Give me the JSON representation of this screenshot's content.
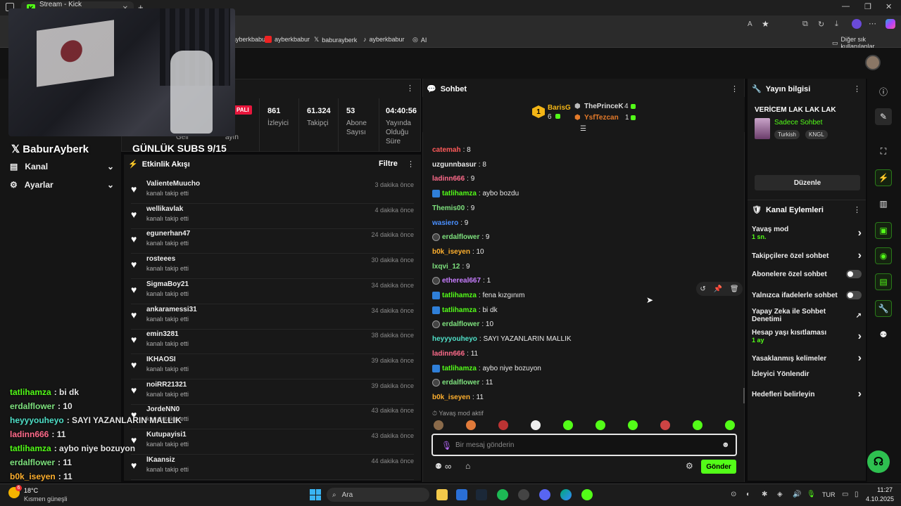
{
  "browser": {
    "tab_title": "Stream - Kick Dashboard",
    "new_tab": "+",
    "bookmarks": [
      "ayberkbabur",
      "ayberkbabur",
      "baburayberk",
      "ayberkbabur",
      "AI"
    ],
    "other_favorites": "Diğer sık kullanılanlar"
  },
  "overlay": {
    "handle": "BaburAyberk",
    "subs_goal": "GÜNLÜK SUBS 9/15"
  },
  "left_nav": [
    {
      "label": "Kanal"
    },
    {
      "label": "Ayarlar"
    }
  ],
  "overlay_chat": [
    {
      "user": "tatlihamza",
      "msg": ": bi dk",
      "color": "#53fc18"
    },
    {
      "user": "erdalflower",
      "msg": ": 10",
      "color": "#7ee27e"
    },
    {
      "user": "heyyyouheyo",
      "msg": ": SAYI YAZANLARIN MALLIK",
      "color": "#4fe0c8"
    },
    {
      "user": "ladinn666",
      "msg": ": 11",
      "color": "#ff6b8b"
    },
    {
      "user": "tatlihamza",
      "msg": ": aybo niye bozuyon",
      "color": "#53fc18"
    },
    {
      "user": "erdalflower",
      "msg": ": 11",
      "color": "#7ee27e"
    },
    {
      "user": "b0k_iseyen",
      "msg": ": 11",
      "color": "#ffb02e"
    }
  ],
  "stats": {
    "live_badge": "PALI",
    "partial1": "Geli",
    "partial2": "klu\nayın",
    "items": [
      {
        "value": "861",
        "label": "İzleyici"
      },
      {
        "value": "61.324",
        "label": "Takipçi"
      },
      {
        "value": "53",
        "label": "Abone Sayısı"
      },
      {
        "value": "04:40:56",
        "label": "Yayında Olduğu Süre"
      }
    ]
  },
  "activity": {
    "title": "Etkinlik Akışı",
    "filter": "Filtre",
    "items": [
      {
        "name": "ValienteMuucho",
        "sub": "kanalı takip etti",
        "time": "3 dakika önce"
      },
      {
        "name": "wellikavlak",
        "sub": "kanalı takip etti",
        "time": "4 dakika önce"
      },
      {
        "name": "egunerhan47",
        "sub": "kanalı takip etti",
        "time": "24 dakika önce"
      },
      {
        "name": "rosteees",
        "sub": "kanalı takip etti",
        "time": "30 dakika önce"
      },
      {
        "name": "SigmaBoy21",
        "sub": "kanalı takip etti",
        "time": "34 dakika önce"
      },
      {
        "name": "ankaramessi31",
        "sub": "kanalı takip etti",
        "time": "34 dakika önce"
      },
      {
        "name": "emin3281",
        "sub": "kanalı takip etti",
        "time": "38 dakika önce"
      },
      {
        "name": "IKHAOSI",
        "sub": "kanalı takip etti",
        "time": "39 dakika önce"
      },
      {
        "name": "noiRR21321",
        "sub": "kanalı takip etti",
        "time": "39 dakika önce"
      },
      {
        "name": "JordeNN0",
        "sub": "kanalı takip etti",
        "time": "43 dakika önce"
      },
      {
        "name": "Kutupayisi1",
        "sub": "kanalı takip etti",
        "time": "43 dakika önce"
      },
      {
        "name": "lKaansiz",
        "sub": "kanalı takip etti",
        "time": "44 dakika önce"
      }
    ]
  },
  "chat": {
    "title": "Sohbet",
    "leaderboard": {
      "first_rank": "1",
      "first_user": "BarisG",
      "first_count": "6",
      "second_user": "ThePrinceK",
      "second_count": "4",
      "third_user": "YsfTezcan",
      "third_count": "1"
    },
    "messages": [
      {
        "user": "catemah",
        "text": ": 8",
        "color": "#ff5a5a",
        "badge": ""
      },
      {
        "user": "uzgunnbasur",
        "text": ": 8",
        "color": "#e8e8e8",
        "badge": ""
      },
      {
        "user": "ladinn666",
        "text": ": 9",
        "color": "#ff6b8b",
        "badge": ""
      },
      {
        "user": "tatlihamza",
        "text": ": aybo bozdu",
        "color": "#53fc18",
        "badge": "blue"
      },
      {
        "user": "Themis00",
        "text": ": 9",
        "color": "#7ee27e",
        "badge": ""
      },
      {
        "user": "wasiero",
        "text": ": 9",
        "color": "#4a90ff",
        "badge": ""
      },
      {
        "user": "erdalflower",
        "text": ": 9",
        "color": "#7ee27e",
        "badge": "gray"
      },
      {
        "user": "b0k_iseyen",
        "text": ": 10",
        "color": "#ffb02e",
        "badge": ""
      },
      {
        "user": "lxqvi_12",
        "text": ": 9",
        "color": "#7ee27e",
        "badge": ""
      },
      {
        "user": "ethereal667",
        "text": ": 1",
        "color": "#c77dff",
        "badge": "gray"
      },
      {
        "user": "tatlihamza",
        "text": ": fena kızgınım",
        "color": "#53fc18",
        "badge": "blue"
      },
      {
        "user": "tatlihamza",
        "text": ": bi dk",
        "color": "#53fc18",
        "badge": "blue"
      },
      {
        "user": "erdalflower",
        "text": ": 10",
        "color": "#7ee27e",
        "badge": "gray"
      },
      {
        "user": "heyyyouheyo",
        "text": ": SAYI YAZANLARIN MALLIK",
        "color": "#4fe0c8",
        "badge": ""
      },
      {
        "user": "ladinn666",
        "text": ": 11",
        "color": "#ff6b8b",
        "badge": ""
      },
      {
        "user": "tatlihamza",
        "text": ": aybo niye bozuyon",
        "color": "#53fc18",
        "badge": "blue"
      },
      {
        "user": "erdalflower",
        "text": ": 11",
        "color": "#7ee27e",
        "badge": "gray"
      },
      {
        "user": "b0k_iseyen",
        "text": ": 11",
        "color": "#ffb02e",
        "badge": ""
      }
    ],
    "slow_mode_note": "Yavaş mod aktif",
    "input_placeholder": "Bir mesaj gönderin",
    "send": "Gönder",
    "infinity": "∞"
  },
  "stream_info": {
    "title": "Yayın bilgisi",
    "stream_title": "VERİCEM LAK LAK LAK",
    "category": "Sadece Sohbet",
    "tags": [
      "Turkish",
      "KNGL"
    ],
    "edit": "Düzenle"
  },
  "channel_actions": {
    "title": "Kanal Eylemleri",
    "rows": [
      {
        "label": "Yavaş mod",
        "sub": "1 sn.",
        "control": "chevron"
      },
      {
        "label": "Takipçilere özel sohbet",
        "sub": "",
        "control": "chevron"
      },
      {
        "label": "Abonelere özel sohbet",
        "sub": "",
        "control": "toggle"
      },
      {
        "label": "Yalnızca ifadelerle sohbet",
        "sub": "",
        "control": "toggle"
      },
      {
        "label": "Yapay Zeka ile Sohbet Denetimi",
        "sub": "",
        "control": "external"
      },
      {
        "label": "Hesap yaşı kısıtlaması",
        "sub": "1 ay",
        "control": "chevron"
      },
      {
        "label": "Yasaklanmış kelimeler",
        "sub": "",
        "control": "chevron"
      },
      {
        "label": "İzleyici Yönlendir",
        "sub": "",
        "control": "none"
      },
      {
        "label": "Hedefleri belirleyin",
        "sub": "",
        "control": "chevron"
      }
    ]
  },
  "taskbar": {
    "weather_temp": "18°C",
    "weather_desc": "Kısmen güneşli",
    "search": "Ara",
    "lang": "TUR",
    "time": "11:27",
    "date": "4.10.2025",
    "notif_badge": "6"
  }
}
